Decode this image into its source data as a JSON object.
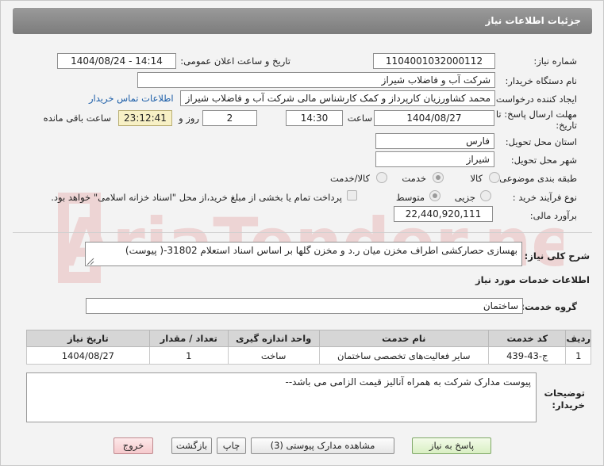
{
  "header": {
    "title": "جزئیات اطلاعات نیاز"
  },
  "fields": {
    "need_number_label": "شماره نیاز:",
    "need_number": "1104001032000112",
    "announce_label": "تاریخ و ساعت اعلان عمومی:",
    "announce_value": "1404/08/24 - 14:14",
    "buyer_org_label": "نام دستگاه خریدار:",
    "buyer_org": "شرکت آب و فاضلاب شیراز",
    "creator_label": "ایجاد کننده درخواست:",
    "creator": "محمد کشاورزیان کارپرداز و کمک کارشناس مالی شرکت آب و فاضلاب شیراز",
    "contact_link": "اطلاعات تماس خریدار",
    "deadline_label_1": "مهلت ارسال پاسخ: تا",
    "deadline_label_2": "تاریخ:",
    "deadline_date": "1404/08/27",
    "time_label": "ساعت",
    "deadline_time": "14:30",
    "days_value": "2",
    "days_label": "روز و",
    "remaining_time": "23:12:41",
    "remaining_label": "ساعت باقی مانده",
    "province_label": "استان محل تحویل:",
    "province": "فارس",
    "city_label": "شهر محل تحویل:",
    "city": "شیراز",
    "category_label": "طبقه بندی موضوعی:",
    "category_options": [
      "کالا",
      "خدمت",
      "کالا/خدمت"
    ],
    "process_label": "نوع فرآیند خرید :",
    "process_options": [
      "جزیی",
      "متوسط"
    ],
    "payment_note": "پرداخت تمام یا بخشی از مبلغ خرید،از محل \"اسناد خزانه اسلامی\" خواهد بود.",
    "estimate_label": "برآورد مالی:",
    "estimate": "22,440,920,111"
  },
  "description": {
    "label": "شرح کلی نیاز:",
    "text": "بهسازی حصارکشی اطراف مخزن میان ر.د و مخزن گلها بر اساس اسناد استعلام 31802-( پیوست)"
  },
  "services": {
    "section_title": "اطلاعات خدمات مورد نیاز",
    "group_label": "گروه خدمت:",
    "group_value": "ساختمان",
    "columns": [
      "ردیف",
      "کد خدمت",
      "نام خدمت",
      "واحد اندازه گیری",
      "تعداد / مقدار",
      "تاریخ نیاز"
    ],
    "rows": [
      {
        "row": "1",
        "code": "ج-43-439",
        "name": "سایر فعالیت‌های تخصصی ساختمان",
        "unit": "ساخت",
        "qty": "1",
        "date": "1404/08/27"
      }
    ]
  },
  "notes": {
    "label_1": "توضیحات",
    "label_2": "خریدار:",
    "text": "پیوست مدارک شرکت به همراه آنالیز قیمت الزامی می باشد--"
  },
  "buttons": {
    "reply": "پاسخ به نیاز",
    "attachments": "مشاهده مدارک پیوستی (3)",
    "print": "چاپ",
    "back": "بازگشت",
    "exit": "خروج"
  },
  "watermark": {
    "text": "AriaTender.neT"
  },
  "colors": {
    "header": "#8a8a8a",
    "link": "#1c5ea8",
    "remaining_bg": "#f7f0c5",
    "watermark": "#d33a3a"
  }
}
